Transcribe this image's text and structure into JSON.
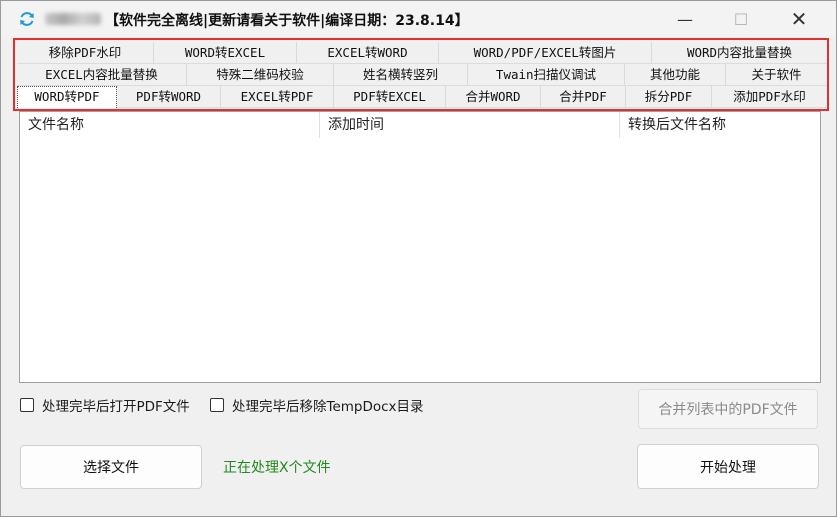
{
  "window": {
    "title": "【软件完全离线|更新请看关于软件|编译日期：23.8.14】",
    "controls": {
      "minimize": "—",
      "maximize": "☐",
      "close": "✕"
    }
  },
  "tabs": {
    "row1": [
      "移除PDF水印",
      "WORD转EXCEL",
      "EXCEL转WORD",
      "WORD/PDF/EXCEL转图片",
      "WORD内容批量替换"
    ],
    "row2": [
      "EXCEL内容批量替换",
      "特殊二维码校验",
      "姓名横转竖列",
      "Twain扫描仪调试",
      "其他功能",
      "关于软件"
    ],
    "row3": [
      "WORD转PDF",
      "PDF转WORD",
      "EXCEL转PDF",
      "PDF转EXCEL",
      "合并WORD",
      "合并PDF",
      "拆分PDF",
      "添加PDF水印"
    ],
    "active": "WORD转PDF"
  },
  "file_list": {
    "columns": [
      "文件名称",
      "添加时间",
      "转换后文件名称"
    ],
    "rows": []
  },
  "options": {
    "open_pdf_after": {
      "label": "处理完毕后打开PDF文件",
      "checked": false
    },
    "remove_temp_dir": {
      "label": "处理完毕后移除TempDocx目录",
      "checked": false
    }
  },
  "buttons": {
    "merge_pdf": "合并列表中的PDF文件",
    "select_files": "选择文件",
    "start": "开始处理"
  },
  "status": {
    "text": "正在处理X个文件",
    "color": "#1f8a1f"
  },
  "colors": {
    "highlight_border": "#e03030",
    "accent_icon": "#1e9bd7"
  }
}
